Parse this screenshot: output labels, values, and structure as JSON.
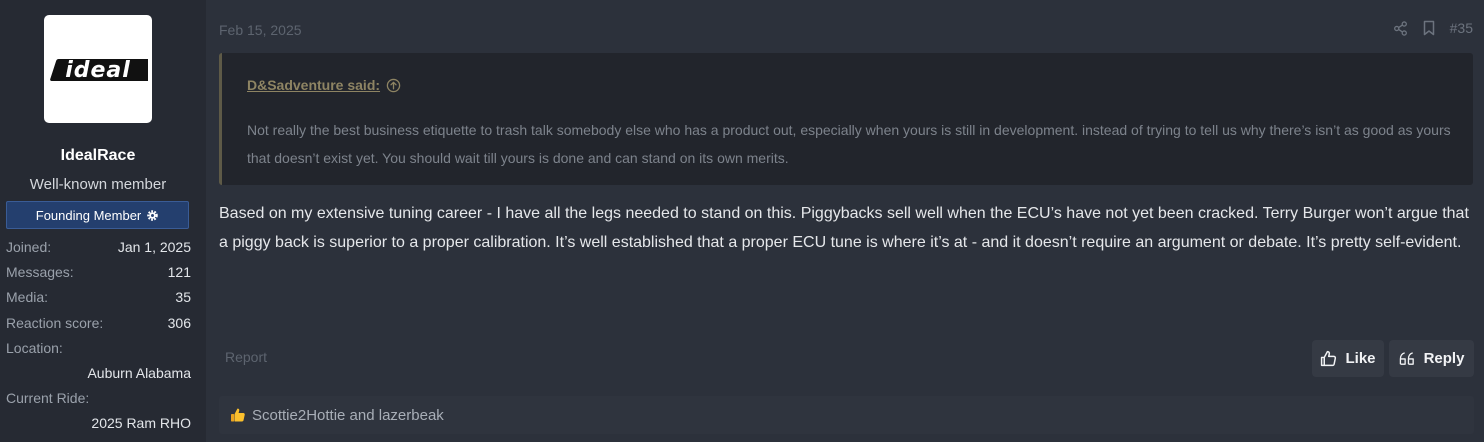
{
  "user": {
    "avatar_text": "ideal",
    "username": "IdealRace",
    "title": "Well-known member",
    "badge": "Founding Member",
    "stats": [
      {
        "label": "Joined:",
        "value": "Jan 1, 2025"
      },
      {
        "label": "Messages:",
        "value": "121"
      },
      {
        "label": "Media:",
        "value": "35"
      },
      {
        "label": "Reaction score:",
        "value": "306"
      }
    ],
    "location_label": "Location:",
    "location_value": "Auburn Alabama",
    "ride_label": "Current Ride:",
    "ride_value": "2025 Ram RHO"
  },
  "post": {
    "date": "Feb 15, 2025",
    "number": "#35",
    "quote": {
      "author": "D&Sadventure said:",
      "text": "Not really the best business etiquette to trash talk somebody else who has a product out, especially when yours is still in development. instead of trying to tell us why there’s isn’t as good as yours that doesn’t exist yet. You should wait till yours is done and can stand on its own merits."
    },
    "message": "Based on my extensive tuning career - I have all the legs needed to stand on this. Piggybacks sell well when the ECU’s have not yet been cracked. Terry Burger won’t argue that a piggy back is superior to a proper calibration. It’s well established that a proper ECU tune is where it’s at - and it doesn’t require an argument or debate. It’s pretty self-evident.",
    "report_label": "Report",
    "like_label": "Like",
    "reply_label": "Reply",
    "reactions_text": "Scottie2Hottie and lazerbeak"
  },
  "icons": {
    "share": "share-icon",
    "bookmark": "bookmark-icon",
    "quote_link": "arrow-up-circle-icon",
    "badge": "gear-icon",
    "like": "thumbs-up-icon",
    "reply": "quote-marks-icon",
    "reaction": "thumbs-up-emoji-icon"
  },
  "colors": {
    "background": "#2c313b",
    "sidebar": "#262a33",
    "badge": "#243f6e",
    "quote_author": "#8e8463"
  }
}
